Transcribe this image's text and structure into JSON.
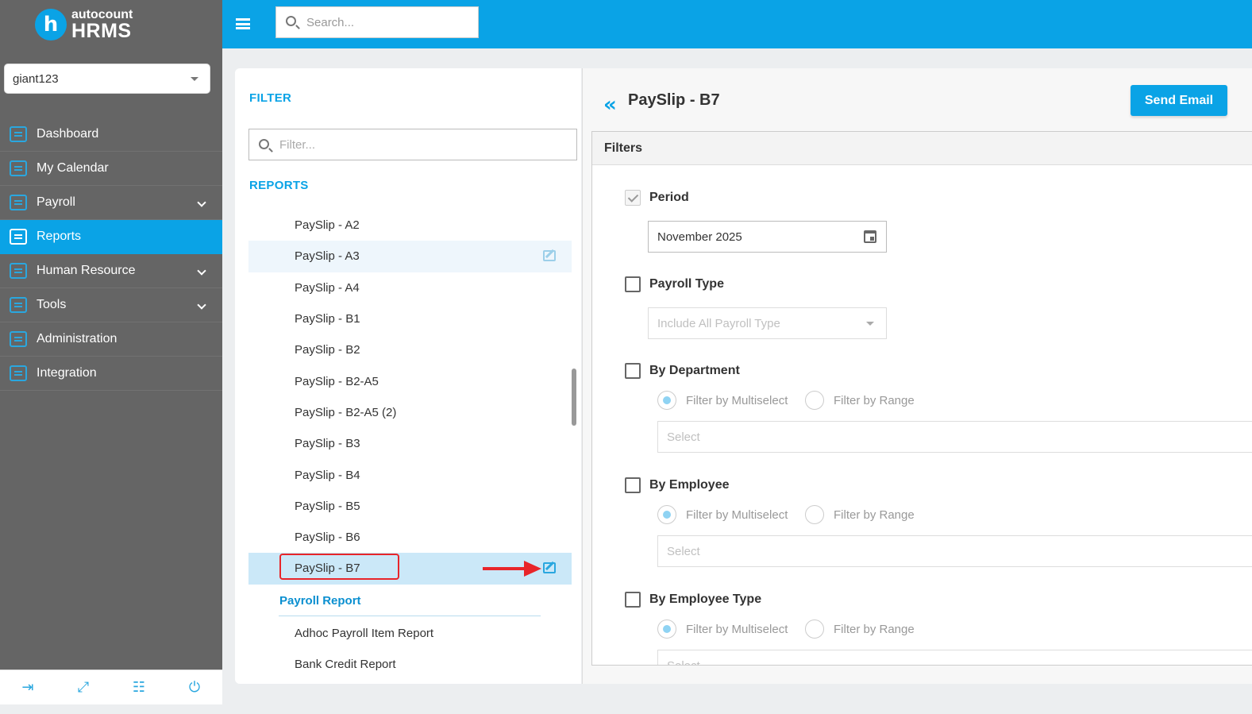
{
  "app": {
    "logo_top": "autocount",
    "logo_bottom": "HRMS",
    "logo_letter": "h"
  },
  "company": {
    "value": "giant123"
  },
  "nav": {
    "items": [
      {
        "label": "Dashboard",
        "icon": "dashboard-icon"
      },
      {
        "label": "My Calendar",
        "icon": "calendar-icon"
      },
      {
        "label": "Payroll",
        "icon": "payroll-icon",
        "expandable": true
      },
      {
        "label": "Reports",
        "icon": "reports-icon",
        "active": true
      },
      {
        "label": "Human Resource",
        "icon": "human-resource-icon",
        "expandable": true
      },
      {
        "label": "Tools",
        "icon": "tools-icon",
        "expandable": true
      },
      {
        "label": "Administration",
        "icon": "administration-icon"
      },
      {
        "label": "Integration",
        "icon": "integration-icon"
      }
    ]
  },
  "bottom_bar": {
    "icons": [
      "logout-icon",
      "fullscreen-icon",
      "translate-icon",
      "power-icon"
    ]
  },
  "search": {
    "placeholder": "Search..."
  },
  "filter_panel": {
    "filter_title": "FILTER",
    "filter_placeholder": "Filter...",
    "reports_title": "REPORTS",
    "reports": [
      "PaySlip - A2",
      "PaySlip - A3",
      "PaySlip - A4",
      "PaySlip - B1",
      "PaySlip - B2",
      "PaySlip - B2-A5",
      "PaySlip - B2-A5 (2)",
      "PaySlip - B3",
      "PaySlip - B4",
      "PaySlip - B5",
      "PaySlip - B6",
      "PaySlip - B7"
    ],
    "group_header": "Payroll Report",
    "group_items": [
      "Adhoc Payroll Item Report",
      "Bank Credit Report"
    ]
  },
  "report": {
    "title": "PaySlip - B7",
    "send_email_label": "Send Email",
    "filters_header": "Filters",
    "period_label": "Period",
    "period_value": "November 2025",
    "payroll_type_label": "Payroll Type",
    "payroll_type_placeholder": "Include All Payroll Type",
    "by_department_label": "By Department",
    "by_employee_label": "By Employee",
    "by_employee_type_label": "By Employee Type",
    "filter_multiselect": "Filter by Multiselect",
    "filter_range": "Filter by Range",
    "select_placeholder": "Select"
  },
  "colors": {
    "accent": "#0aa3e6",
    "sidebar": "#656565",
    "highlight": "#e8252a"
  }
}
